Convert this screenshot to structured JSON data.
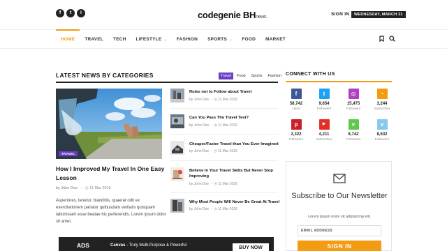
{
  "header": {
    "social": [
      "f",
      "t",
      "i"
    ],
    "logo_main": "codegenie BH",
    "logo_suffix": "news.",
    "signin": "SIGN IN",
    "date": "WEDNESDAY, MARCH 31"
  },
  "nav": {
    "items": [
      {
        "label": "HOME",
        "caret": ""
      },
      {
        "label": "TRAVEL",
        "caret": ""
      },
      {
        "label": "TECH",
        "caret": ""
      },
      {
        "label": "LIFESTYLE",
        "caret": "⌄"
      },
      {
        "label": "FASHION",
        "caret": ""
      },
      {
        "label": "SPORTS",
        "caret": "⌄"
      },
      {
        "label": "FOOD",
        "caret": ""
      },
      {
        "label": "MARKET",
        "caret": ""
      }
    ],
    "icons": [
      "bookmark-icon",
      "search-icon"
    ]
  },
  "section": {
    "title": "LATEST NEWS BY CATEGORIES",
    "tabs": [
      "Travel",
      "Food",
      "Sports",
      "Fashion"
    ]
  },
  "feature": {
    "tag": "TRAVEL",
    "title": "How I Improved My Travel In One Easy Lesson",
    "author": "by John Doe",
    "date": "11 Mar 2016",
    "excerpt": "Asperiores, tenetur, blanditiis, quaerat odit ex exercitationem pariatur quibusdam veritatis quisquam laboriosam esse beatae hic perferendis. Lorem ipsum dolor sit amet."
  },
  "list": [
    {
      "title": "Rules not to Follow about Travel",
      "author": "by John Doe",
      "date": "11 Mar 2016"
    },
    {
      "title": "Can You Pass The Travel Test?",
      "author": "by John Doe",
      "date": "11 Mar 2016"
    },
    {
      "title": "Cheaper/Faster Travel than You Ever Imagined",
      "author": "by John Doe",
      "date": "11 Mar 2016"
    },
    {
      "title": "Believe In Your Travel Skills But Never Stop Improving",
      "author": "by John Doe",
      "date": "11 Mar 2016"
    },
    {
      "title": "Why Most People Will Never Be Great At Travel",
      "author": "by John Doe",
      "date": "11 Mar 2016"
    }
  ],
  "sidebar": {
    "title": "CONNECT WITH US",
    "socials": [
      {
        "icon": "facebook-icon",
        "glyph": "f",
        "count": "58,742",
        "label": "Likes",
        "color": "#3b5998"
      },
      {
        "icon": "twitter-icon",
        "glyph": "t",
        "count": "9,654",
        "label": "Followers",
        "color": "#1da1f2"
      },
      {
        "icon": "instagram-icon",
        "glyph": "◎",
        "count": "15,475",
        "label": "Followers",
        "color": "#b23fc2"
      },
      {
        "icon": "rss-icon",
        "glyph": "◔",
        "count": "3,244",
        "label": "Subscriber",
        "color": "#f39c12"
      },
      {
        "icon": "pinterest-icon",
        "glyph": "p",
        "count": "2,322",
        "label": "Followers",
        "color": "#cb2027"
      },
      {
        "icon": "youtube-icon",
        "glyph": "▶",
        "count": "4,211",
        "label": "Subscriber",
        "color": "#e52d27"
      },
      {
        "icon": "vine-icon",
        "glyph": "v",
        "count": "6,742",
        "label": "Followers",
        "color": "#5fc74b"
      },
      {
        "icon": "vimeo-icon",
        "glyph": "v",
        "count": "8,532",
        "label": "Followers",
        "color": "#86c9ef"
      }
    ]
  },
  "newsletter": {
    "title": "Subscribe to Our Newsletter",
    "subtitle": "Lorem ipsum dolor sit adipisicing elit.",
    "placeholder": "EMAIL ADDRESS",
    "button": "SIGN IN"
  },
  "ad": {
    "label": "ADS",
    "brand": "Canvas",
    "text": " - Truly Multi-Purpose & Powerful",
    "button": "BUY NOW"
  },
  "colors": {
    "accent": "#f39c12",
    "purple": "#6c3ec8",
    "dark": "#222222"
  }
}
